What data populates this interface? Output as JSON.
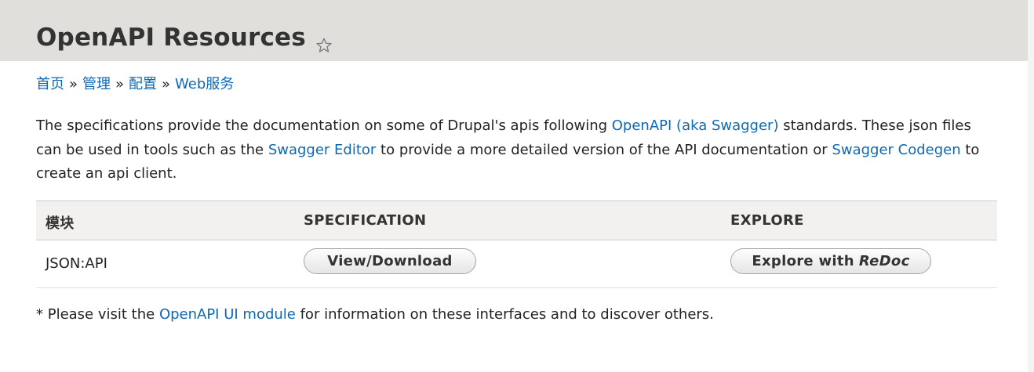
{
  "page": {
    "title": "OpenAPI Resources"
  },
  "icons": {
    "favorite": "star-outline-icon"
  },
  "breadcrumb": {
    "items": [
      "首页",
      "管理",
      "配置",
      "Web服务"
    ],
    "separator": "»"
  },
  "intro": {
    "part1": "The specifications provide the documentation on some of Drupal's apis following ",
    "link1": "OpenAPI (aka Swagger)",
    "part2": " standards. These json files can be used in tools such as the ",
    "link2": "Swagger Editor",
    "part3": " to provide a more detailed version of the API documentation or ",
    "link3": "Swagger Codegen",
    "part4": " to create an api client."
  },
  "table": {
    "headers": [
      "模块",
      "SPECIFICATION",
      "EXPLORE"
    ],
    "rows": [
      {
        "module": "JSON:API",
        "spec_button": "View/Download",
        "explore_button_prefix": "Explore with",
        "explore_button_em": "ReDoc"
      }
    ]
  },
  "footnote": {
    "prefix": "* Please visit the ",
    "link": "OpenAPI UI module",
    "suffix": " for information on these interfaces and to discover others."
  },
  "colors": {
    "link": "#0e69b5",
    "header_bg": "#e0dfdc",
    "table_header_bg": "#f2f1ef",
    "text": "#222222"
  }
}
